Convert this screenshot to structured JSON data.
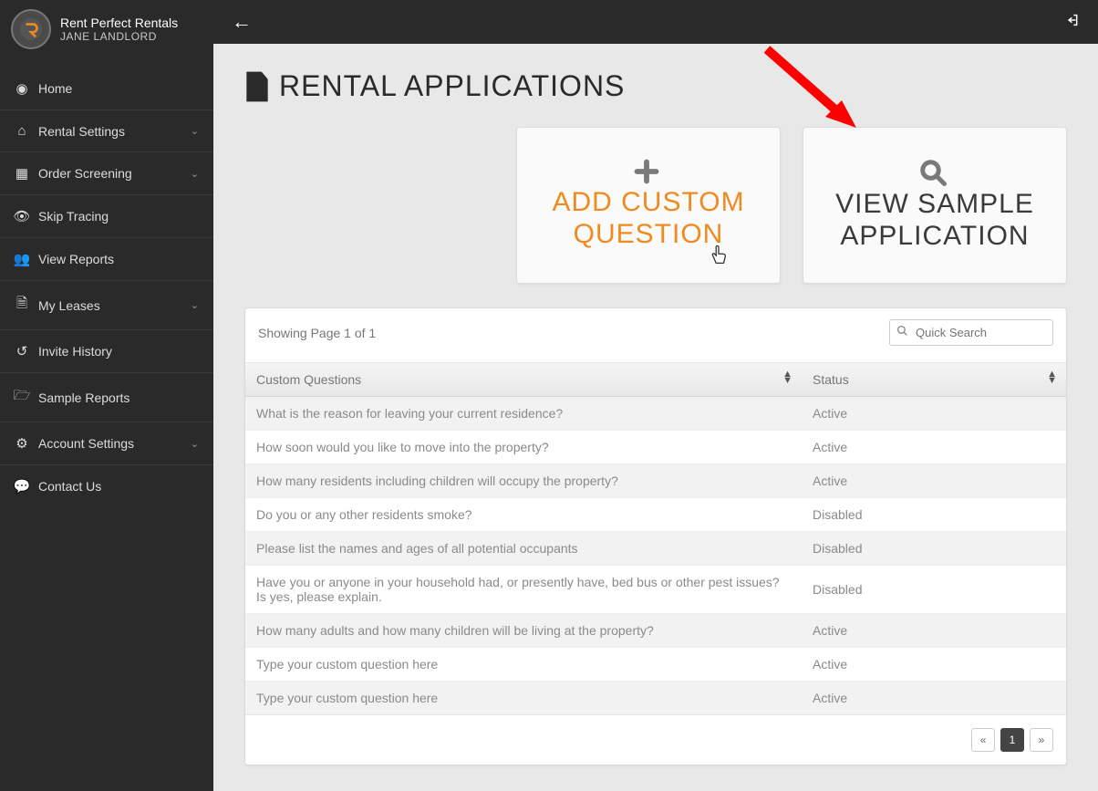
{
  "sidebar": {
    "app_name": "Rent Perfect Rentals",
    "user_name": "JANE LANDLORD",
    "items": [
      {
        "label": "Home",
        "glyph": "◉",
        "expandable": false
      },
      {
        "label": "Rental Settings",
        "glyph": "⌂",
        "expandable": true
      },
      {
        "label": "Order Screening",
        "glyph": "▦",
        "expandable": true
      },
      {
        "label": "Skip Tracing",
        "glyph": "👁",
        "expandable": false
      },
      {
        "label": "View Reports",
        "glyph": "👥",
        "expandable": false
      },
      {
        "label": "My Leases",
        "glyph": "🗎",
        "expandable": true
      },
      {
        "label": "Invite History",
        "glyph": "↺",
        "expandable": false
      },
      {
        "label": "Sample Reports",
        "glyph": "🗁",
        "expandable": false
      },
      {
        "label": "Account Settings",
        "glyph": "⚙",
        "expandable": true
      },
      {
        "label": "Contact Us",
        "glyph": "💬",
        "expandable": false
      }
    ]
  },
  "page": {
    "title": "RENTAL APPLICATIONS"
  },
  "actions": {
    "add": "ADD CUSTOM QUESTION",
    "view": "VIEW SAMPLE APPLICATION"
  },
  "table": {
    "pager_text": "Showing Page 1 of 1",
    "search_placeholder": "Quick Search",
    "columns": {
      "question": "Custom Questions",
      "status": "Status"
    },
    "rows": [
      {
        "q": "What is the reason for leaving your current residence?",
        "s": "Active"
      },
      {
        "q": "How soon would you like to move into the property?",
        "s": "Active"
      },
      {
        "q": "How many residents including children will occupy the property?",
        "s": "Active"
      },
      {
        "q": "Do you or any other residents smoke?",
        "s": "Disabled"
      },
      {
        "q": "Please list the names and ages of all potential occupants",
        "s": "Disabled"
      },
      {
        "q": "Have you or anyone in your household had, or presently have, bed bus or other pest issues? Is yes, please explain.",
        "s": "Disabled"
      },
      {
        "q": "How many adults and how many children will be living at the property?",
        "s": "Active"
      },
      {
        "q": "Type your custom question here",
        "s": "Active"
      },
      {
        "q": "Type your custom question here",
        "s": "Active"
      }
    ],
    "current_page": "1"
  }
}
